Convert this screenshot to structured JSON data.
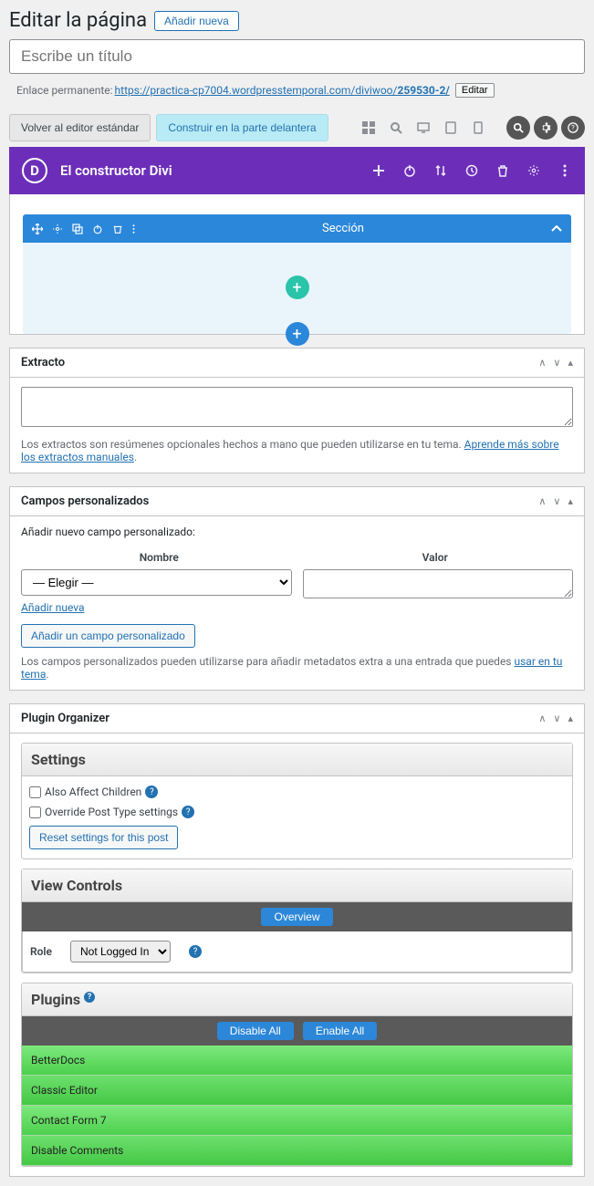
{
  "header": {
    "title": "Editar la página",
    "add_new": "Añadir nueva"
  },
  "title_input": {
    "placeholder": "Escribe un título"
  },
  "permalink": {
    "label": "Enlace permanente:",
    "url_text": "https://practica-cp7004.wordpresstemporal.com/diviwoo/",
    "slug": "259530-2/",
    "edit": "Editar"
  },
  "toolbar": {
    "back": "Volver al editor estándar",
    "build_front": "Construir en la parte delantera"
  },
  "divi": {
    "title": "El constructor Divi",
    "section_label": "Sección"
  },
  "excerpt": {
    "title": "Extracto",
    "help_prefix": "Los extractos son resúmenes opcionales hechos a mano que pueden utilizarse en tu tema. ",
    "help_link": "Aprende más sobre los extractos manuales"
  },
  "custom_fields": {
    "title": "Campos personalizados",
    "add_label": "Añadir nuevo campo personalizado:",
    "col_name": "Nombre",
    "col_value": "Valor",
    "select_placeholder": "— Elegir —",
    "add_new_link": "Añadir nueva",
    "add_btn": "Añadir un campo personalizado",
    "help_prefix": "Los campos personalizados pueden utilizarse para añadir metadatos extra a una entrada que puedes ",
    "help_link": "usar en tu tema"
  },
  "plugin_org": {
    "title": "Plugin Organizer",
    "settings": {
      "heading": "Settings",
      "also_affect": "Also Affect Children",
      "override": "Override Post Type settings",
      "reset": "Reset settings for this post"
    },
    "view_controls": {
      "heading": "View Controls",
      "overview": "Overview",
      "role_label": "Role",
      "role_value": "Not Logged In"
    },
    "plugins": {
      "heading": "Plugins",
      "disable_all": "Disable All",
      "enable_all": "Enable All",
      "list": [
        "BetterDocs",
        "Classic Editor",
        "Contact Form 7",
        "Disable Comments"
      ]
    }
  }
}
